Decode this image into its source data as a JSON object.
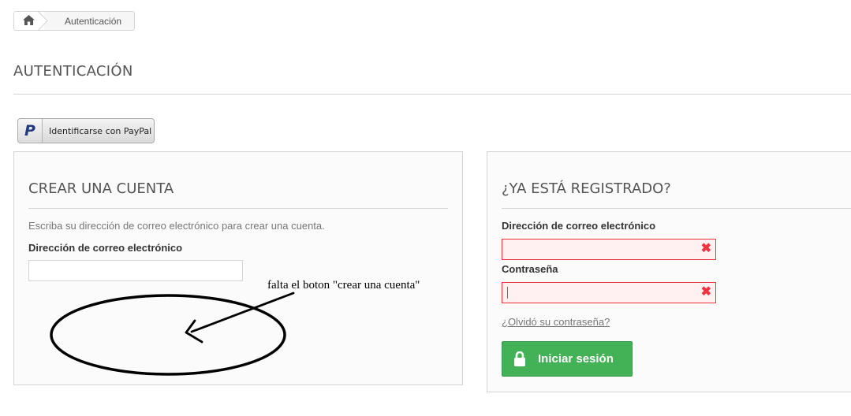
{
  "breadcrumb": {
    "current": "Autenticación"
  },
  "page": {
    "title": "AUTENTICACIÓN"
  },
  "paypal": {
    "logo_text": "P",
    "label": "Identificarse con PayPal"
  },
  "create_account": {
    "heading": "CREAR UNA CUENTA",
    "description": "Escriba su dirección de correo electrónico para crear una cuenta.",
    "email_label": "Dirección de correo electrónico",
    "email_value": ""
  },
  "login": {
    "heading": "¿YA ESTÁ REGISTRADO?",
    "email_label": "Dirección de correo electrónico",
    "email_value": "",
    "password_label": "Contraseña",
    "password_value": "",
    "error_icon": "✖",
    "forgot_link": "¿Olvidó su contraseña?",
    "submit_label": "Iniciar sesión"
  },
  "annotation": {
    "text": "falta el boton \"crear una cuenta\""
  },
  "colors": {
    "accent_green": "#43b155",
    "error_red": "#f13340",
    "border": "#d6d4d4"
  }
}
